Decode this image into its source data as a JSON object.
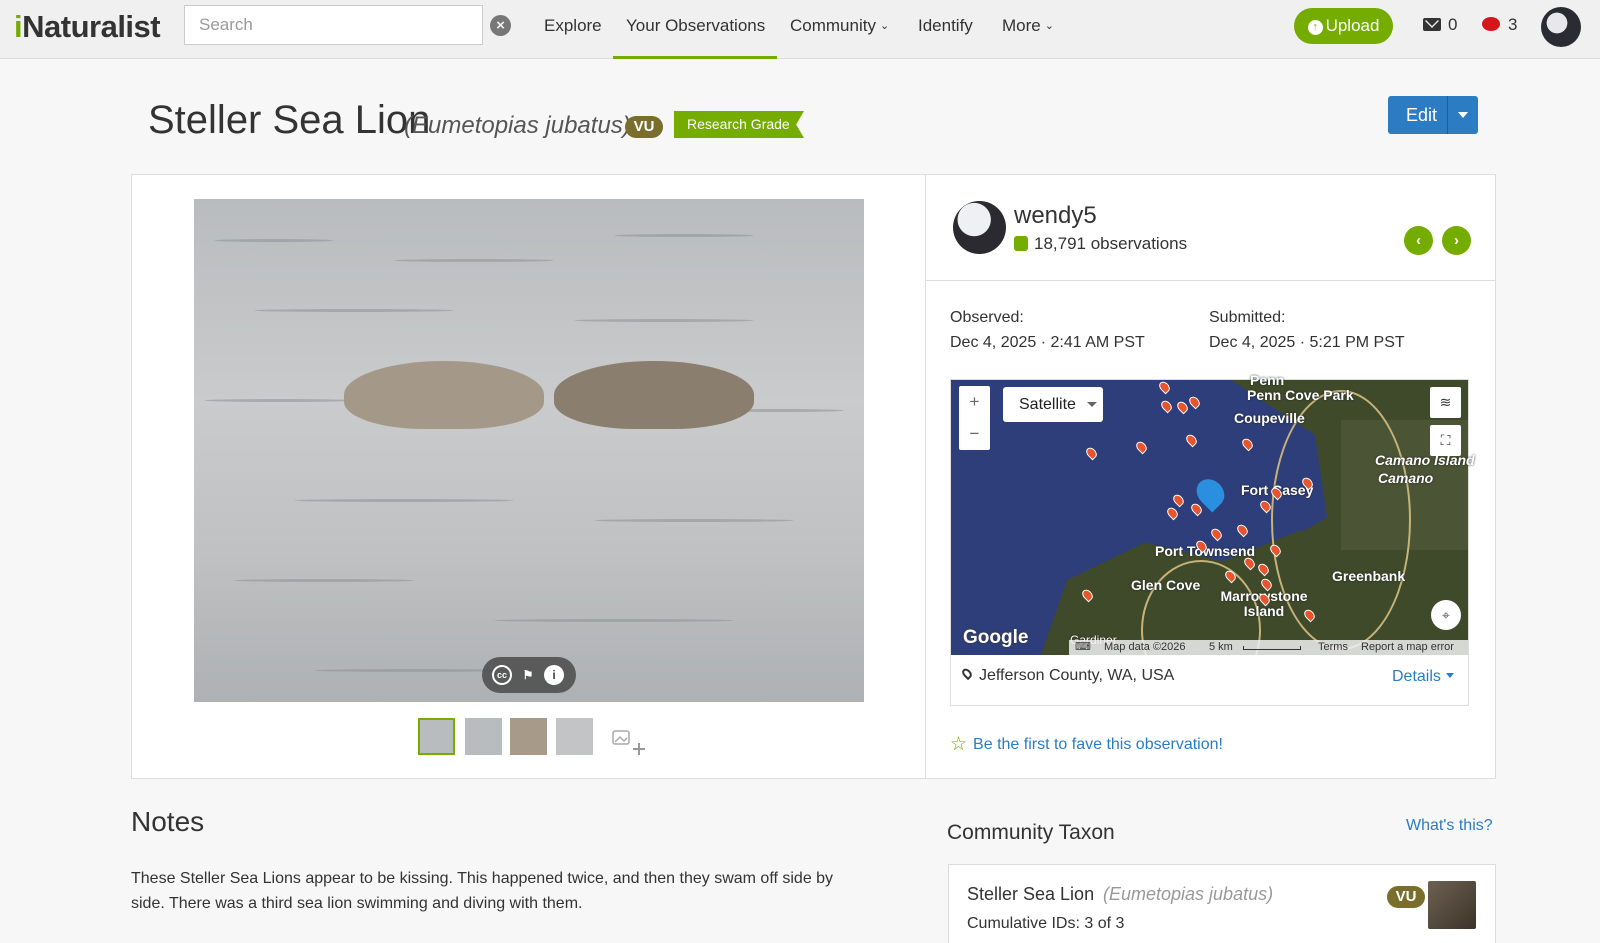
{
  "header": {
    "logo": "iNaturalist",
    "search_placeholder": "Search",
    "nav": [
      "Explore",
      "Your Observations",
      "Community",
      "Identify",
      "More"
    ],
    "upload_label": "Upload",
    "messages_count": "0",
    "notifications_count": "3",
    "accent_color": "#74ac00"
  },
  "title": {
    "common_name": "Steller Sea Lion",
    "scientific_name": "(Eumetopias jubatus)",
    "status_badge": "VU",
    "quality_grade": "Research Grade",
    "edit_label": "Edit"
  },
  "observer": {
    "username": "wendy5",
    "observations": "18,791 observations"
  },
  "dates": {
    "observed_label": "Observed:",
    "observed_value": "Dec 4, 2025 · 2:41 AM PST",
    "submitted_label": "Submitted:",
    "submitted_value": "Dec 4, 2025 · 5:21 PM PST"
  },
  "map": {
    "map_type": "Satellite",
    "zoom_in": "+",
    "zoom_out": "−",
    "places": [
      "Penn Cove Park",
      "Coupeville",
      "Camano Island",
      "Camano",
      "Fort Casey",
      "Port Townsend",
      "Glen Cove",
      "Marrowstone Island",
      "Greenbank",
      "Gardiner"
    ],
    "google_label": "Google",
    "attribution": "Map data ©2026",
    "scale": "5 km",
    "terms": "Terms",
    "report": "Report a map error",
    "location": "Jefferson County, WA, USA",
    "details_label": "Details"
  },
  "fave": {
    "label": "Be the first to fave this observation!"
  },
  "notes": {
    "title": "Notes",
    "text": "These Steller Sea Lions appear to be kissing. This happened twice, and then they swam off side by side. There was a third sea lion swimming and diving with them."
  },
  "community_taxon": {
    "title": "Community Taxon",
    "whats_this": "What's this?",
    "common_name": "Steller Sea Lion",
    "scientific_name": "(Eumetopias jubatus)",
    "status_badge": "VU",
    "cumulative": "Cumulative IDs: 3 of 3"
  }
}
